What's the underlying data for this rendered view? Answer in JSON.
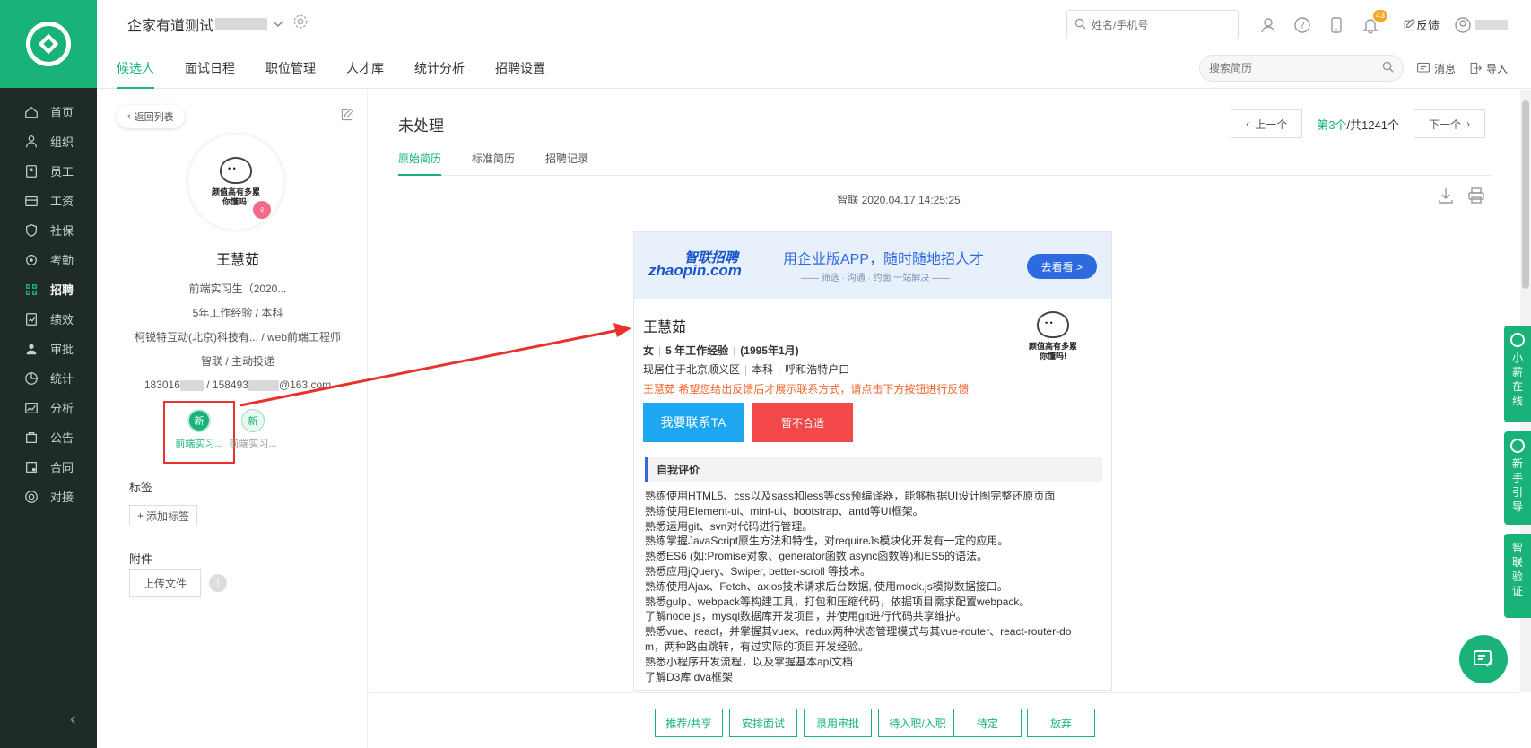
{
  "nav": {
    "items": [
      {
        "label": "首页",
        "icon": "home-icon"
      },
      {
        "label": "组织",
        "icon": "org-icon"
      },
      {
        "label": "员工",
        "icon": "employee-icon"
      },
      {
        "label": "工资",
        "icon": "salary-icon"
      },
      {
        "label": "社保",
        "icon": "shield-icon"
      },
      {
        "label": "考勤",
        "icon": "location-icon"
      },
      {
        "label": "招聘",
        "icon": "recruit-icon",
        "active": true
      },
      {
        "label": "绩效",
        "icon": "performance-icon"
      },
      {
        "label": "审批",
        "icon": "approval-icon"
      },
      {
        "label": "统计",
        "icon": "pie-icon"
      },
      {
        "label": "分析",
        "icon": "analysis-icon"
      },
      {
        "label": "公告",
        "icon": "notice-icon"
      },
      {
        "label": "合同",
        "icon": "contract-icon"
      },
      {
        "label": "对接",
        "icon": "connect-icon"
      }
    ]
  },
  "header": {
    "company": "企家有道测试",
    "search_placeholder": "姓名/手机号",
    "notification_count": "43",
    "feedback": "反馈"
  },
  "tabs": {
    "items": [
      "候选人",
      "面试日程",
      "职位管理",
      "人才库",
      "统计分析",
      "招聘设置"
    ],
    "resume_search_placeholder": "搜索简历",
    "message": "消息",
    "import": "导入"
  },
  "profile": {
    "back": "返回列表",
    "avatar_text1": "颜值高有多累",
    "avatar_text2": "你懂吗!",
    "gender_symbol": "♀",
    "name": "王慧茹",
    "position": "前端实习生（2020...",
    "experience": "5年工作经验 / 本科",
    "company": "柯锐特互动(北京)科技有... / web前端工程师",
    "source": "智联 / 主动投递",
    "phone1": "183016",
    "phone_sep": " / ",
    "phone2": "158493",
    "email_suffix": "@163.com",
    "positions": [
      {
        "badge": "新",
        "label": "前端实习..."
      },
      {
        "badge": "新",
        "label": "前端实习..."
      }
    ],
    "tags_title": "标签",
    "add_tag": "添加标签",
    "attachments_title": "附件",
    "upload": "上传文件",
    "info": "!"
  },
  "main": {
    "status": "未处理",
    "subtabs": [
      "原始简历",
      "标准简历",
      "招聘记录"
    ],
    "prev": "上一个",
    "next": "下一个",
    "page_current": "第3个",
    "page_total": "/共1241个",
    "source_line": "智联   2020.04.17 14:25:25"
  },
  "resume": {
    "logo_cn": "智联招聘",
    "logo_en": "zhaopin.com",
    "banner_title": "用企业版APP，随时随地招人才",
    "banner_sub": "—— 筛选 · 沟通 · 约面 一站解决 ——",
    "banner_button": "去看看 >",
    "name": "王慧茹",
    "gender": "女",
    "exp": "5 年工作经验",
    "birth": "(1995年1月)",
    "residence": "现居住于北京顺义区",
    "degree": "本科",
    "hukou": "呼和浩特户口",
    "warning": "王慧茹   希望您给出反馈后才展示联系方式，请点击下方按钮进行反馈",
    "avatar_text1": "颜值高有多累",
    "avatar_text2": "你懂吗!",
    "contact_btn": "我要联系TA",
    "reject_btn": "暂不合适",
    "section_title": "自我评价",
    "skills": [
      "熟练使用HTML5、css以及sass和less等css预编译器，能够根据UI设计图完整还原页面",
      "熟练使用Element-ui、mint-ui、bootstrap、antd等UI框架。",
      "熟悉运用git、svn对代码进行管理。",
      "熟练掌握JavaScript原生方法和特性，对requireJs模块化开发有一定的应用。",
      "熟悉ES6 (如:Promise对象、generator函数,async函数等)和ES5的语法。",
      "熟悉应用jQuery、Swiper, better-scroll 等技术。",
      "熟练使用Ajax、Fetch、axios技术请求后台数据, 使用mock.js模拟数据接口。",
      "熟悉gulp、webpack等构建工具，打包和压缩代码，依据项目需求配置webpack。",
      "了解node.js，mysql数据库开发项目，并使用git进行代码共享维护。",
      "熟悉vue、react，并掌握其vuex、redux两种状态管理模式与其vue-router、react-router-do",
      "m，两种路由跳转，有过实际的项目开发经验。",
      "熟悉小程序开发流程，以及掌握基本api文档",
      "了解D3库 dva框架"
    ]
  },
  "actions": [
    "推荐/共享",
    "安排面试",
    "录用审批",
    "待入职/入职",
    "待定",
    "放弃"
  ],
  "side": [
    {
      "text": "小薪在线"
    },
    {
      "text": "新手引导"
    },
    {
      "text": "智联验证"
    }
  ],
  "colors": {
    "brand": "#19b37a",
    "nav_bg": "#1e2b27",
    "zhaopin_blue": "#2d6ae0",
    "annotation_red": "#e8322d"
  }
}
